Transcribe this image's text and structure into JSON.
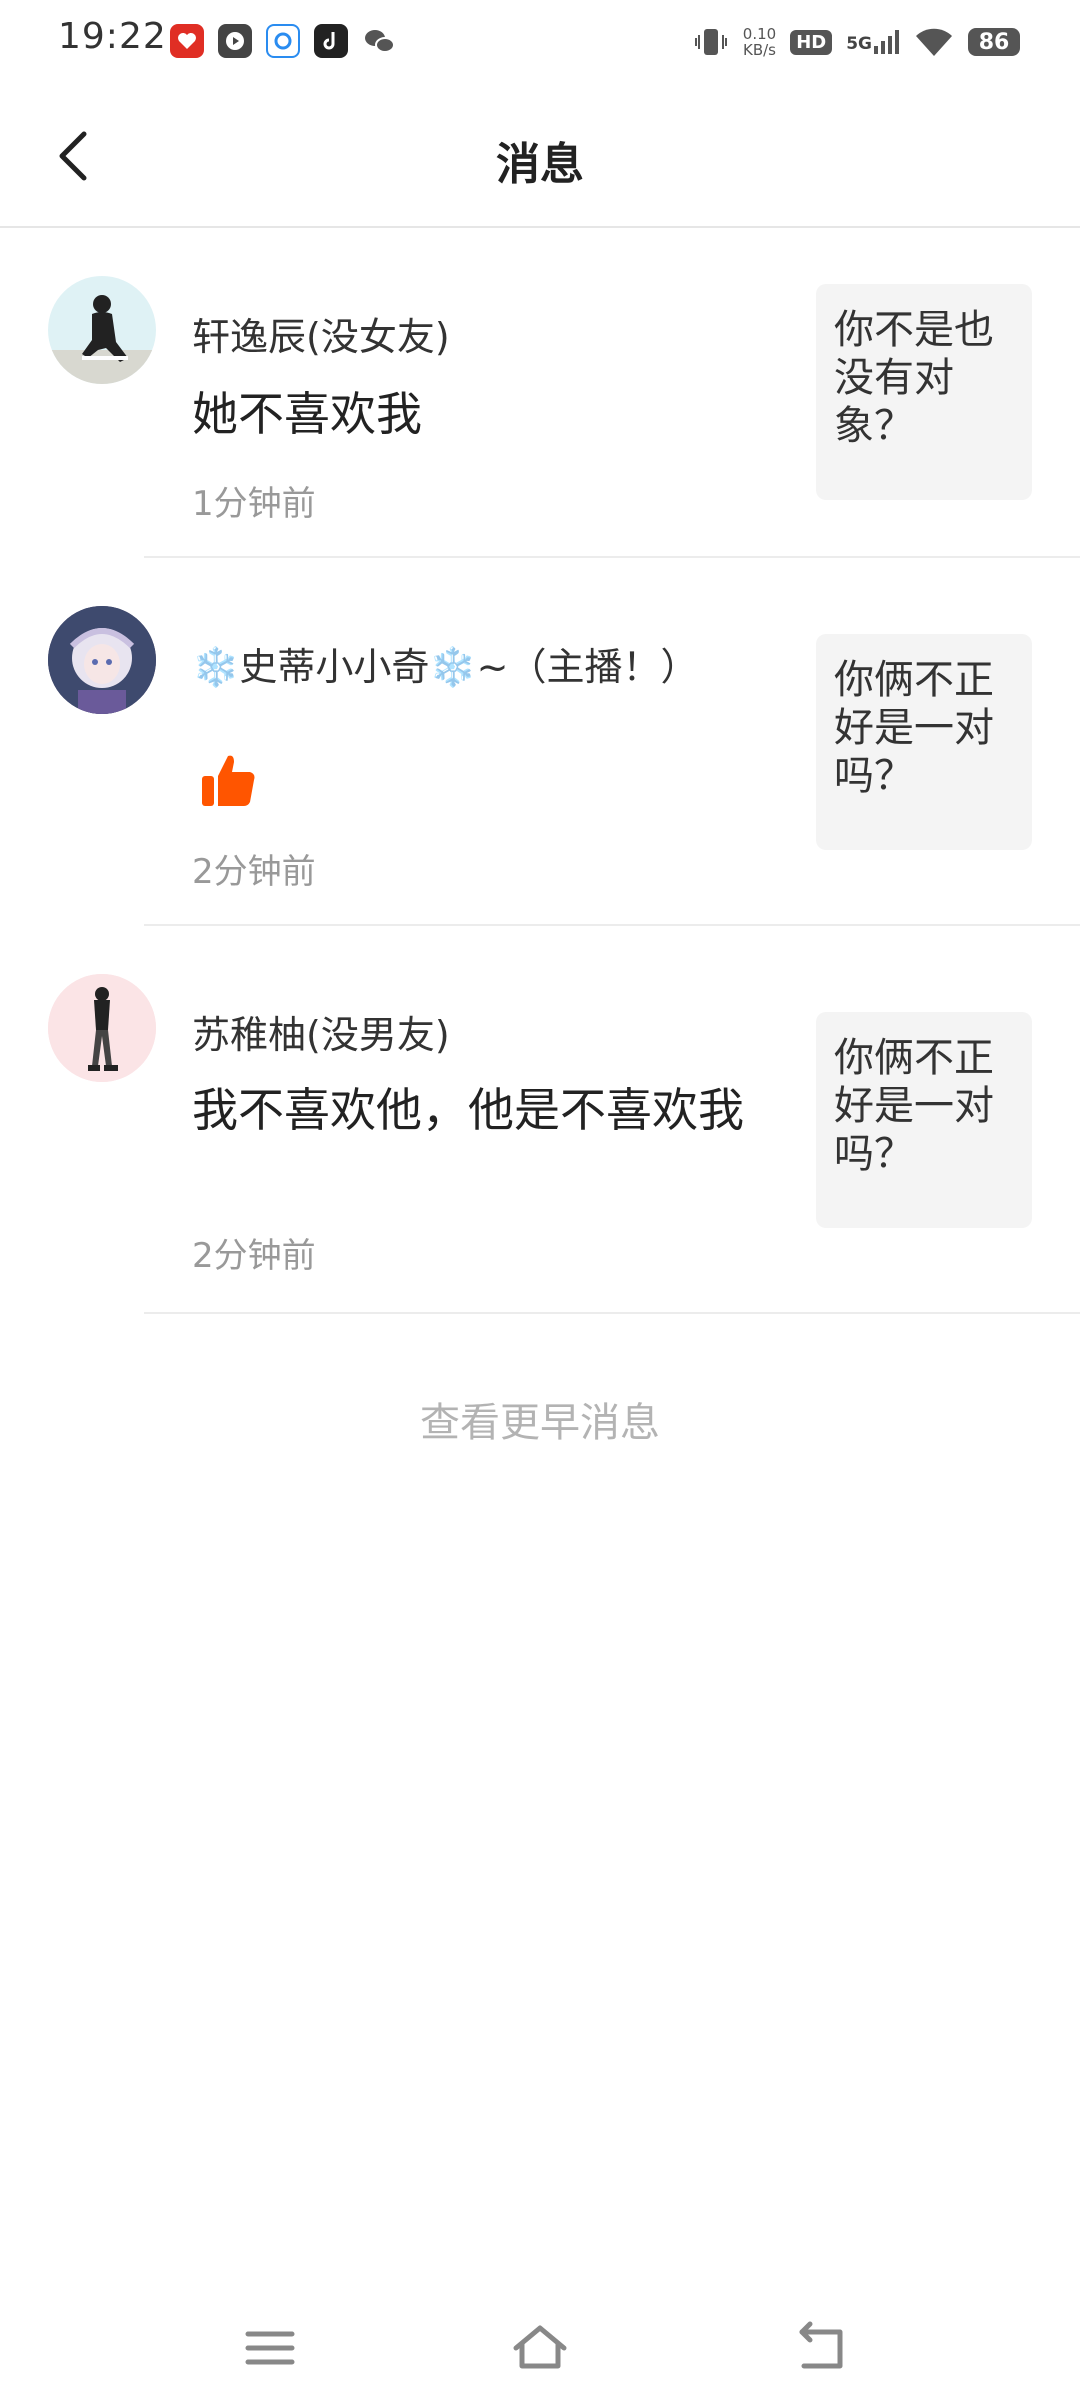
{
  "status_bar": {
    "time": "19:22",
    "net_speed_value": "0.10",
    "net_speed_unit": "KB/s",
    "hd": "HD",
    "network": "5G",
    "battery": "86",
    "app_icons": [
      "pinduoduo-icon",
      "video-icon",
      "browser-icon",
      "tiktok-icon",
      "wechat-icon"
    ]
  },
  "header": {
    "title": "消息"
  },
  "messages": [
    {
      "username": "轩逸辰(没女友)",
      "text": "她不喜欢我",
      "time": "1分钟前",
      "quote": "你不是也没有对象？"
    },
    {
      "username": "❄️史蒂小小奇❄️~（主播！）",
      "text": "",
      "reaction": "thumbs-up",
      "time": "2分钟前",
      "quote": "你俩不正好是一对吗？"
    },
    {
      "username": "苏稚柚(没男友)",
      "text": "我不喜欢他，他是不喜欢我",
      "time": "2分钟前",
      "quote": "你俩不正好是一对吗？"
    }
  ],
  "load_earlier": "查看更早消息",
  "colors": {
    "accent_orange": "#FF5500",
    "muted_text": "#999999",
    "quote_bg": "#F4F4F4"
  }
}
